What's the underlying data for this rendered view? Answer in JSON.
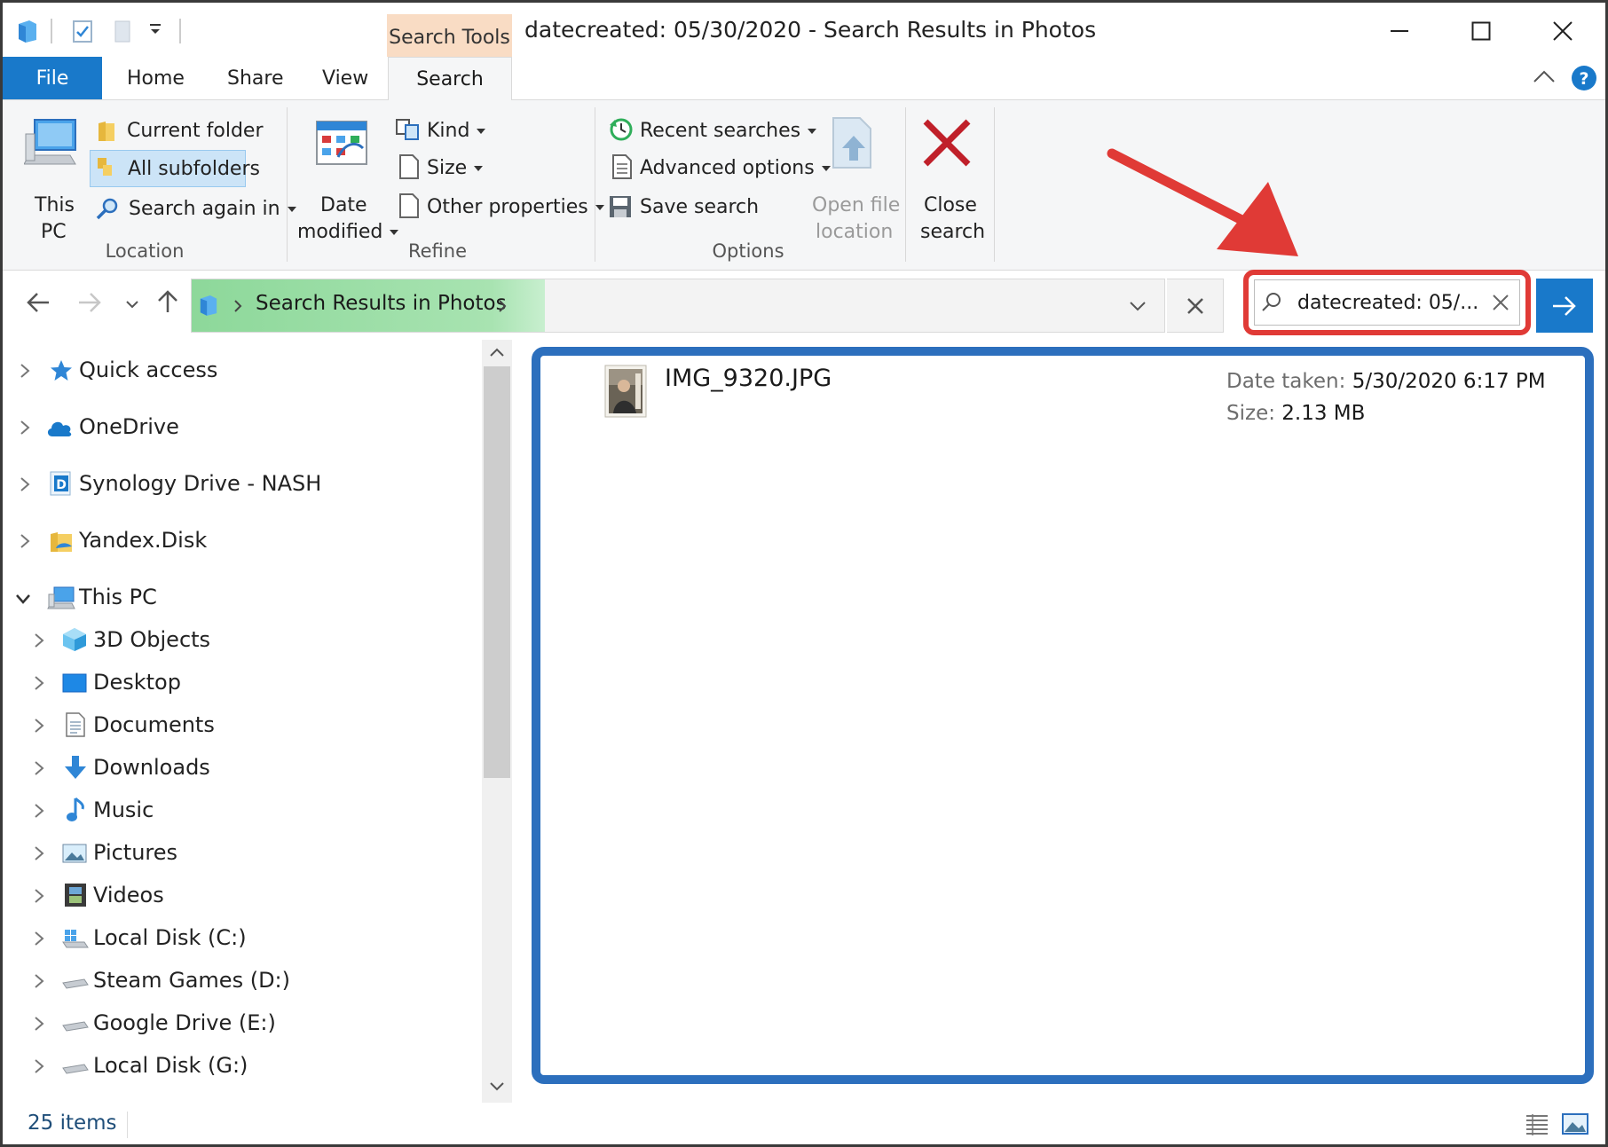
{
  "window": {
    "title": "datecreated: 05/30/2020 - Search Results in Photos",
    "contextual_tab_group": "Search Tools"
  },
  "ribbon_tabs": [
    "File",
    "Home",
    "Share",
    "View",
    "Search"
  ],
  "ribbon": {
    "location": {
      "label": "Location",
      "this_pc": [
        "This",
        "PC"
      ],
      "current_folder": "Current folder",
      "all_subfolders": "All subfolders",
      "search_again_in": "Search again in"
    },
    "refine": {
      "label": "Refine",
      "date_modified": [
        "Date",
        "modified"
      ],
      "kind": "Kind",
      "size": "Size",
      "other_properties": "Other properties"
    },
    "options": {
      "label": "Options",
      "recent_searches": "Recent searches",
      "advanced_options": "Advanced options",
      "save_search": "Save search",
      "open_file_location": [
        "Open file",
        "location"
      ]
    },
    "close_search": [
      "Close",
      "search"
    ]
  },
  "address": {
    "breadcrumb": "Search Results in Photos"
  },
  "search": {
    "value": "datecreated: 05/..."
  },
  "tree": {
    "items": [
      {
        "label": "Quick access",
        "icon": "star-icon"
      },
      {
        "label": "OneDrive",
        "icon": "cloud-icon"
      },
      {
        "label": "Synology Drive - NASH",
        "icon": "synology-drive-icon"
      },
      {
        "label": "Yandex.Disk",
        "icon": "yandex-disk-icon"
      },
      {
        "label": "This PC",
        "icon": "computer-icon"
      },
      {
        "label": "3D Objects",
        "icon": "3d-objects-icon"
      },
      {
        "label": "Desktop",
        "icon": "desktop-icon"
      },
      {
        "label": "Documents",
        "icon": "documents-icon"
      },
      {
        "label": "Downloads",
        "icon": "downloads-icon"
      },
      {
        "label": "Music",
        "icon": "music-icon"
      },
      {
        "label": "Pictures",
        "icon": "pictures-icon"
      },
      {
        "label": "Videos",
        "icon": "videos-icon"
      },
      {
        "label": "Local Disk (C:)",
        "icon": "windows-drive-icon"
      },
      {
        "label": "Steam Games (D:)",
        "icon": "drive-icon"
      },
      {
        "label": "Google Drive (E:)",
        "icon": "drive-icon"
      },
      {
        "label": "Local Disk (G:)",
        "icon": "drive-icon"
      }
    ]
  },
  "result": {
    "name": "IMG_9320.JPG",
    "date_label": "Date taken:",
    "date_value": "5/30/2020 6:17 PM",
    "size_label": "Size:",
    "size_value": "2.13 MB"
  },
  "status": {
    "count": "25 items"
  },
  "colors": {
    "accent": "#1979ca",
    "search_tools_tab": "#f9dcc4",
    "callout_red": "#e03a36",
    "results_border": "#2c6fbd",
    "breadcrumb_green": "#8dd89a"
  }
}
